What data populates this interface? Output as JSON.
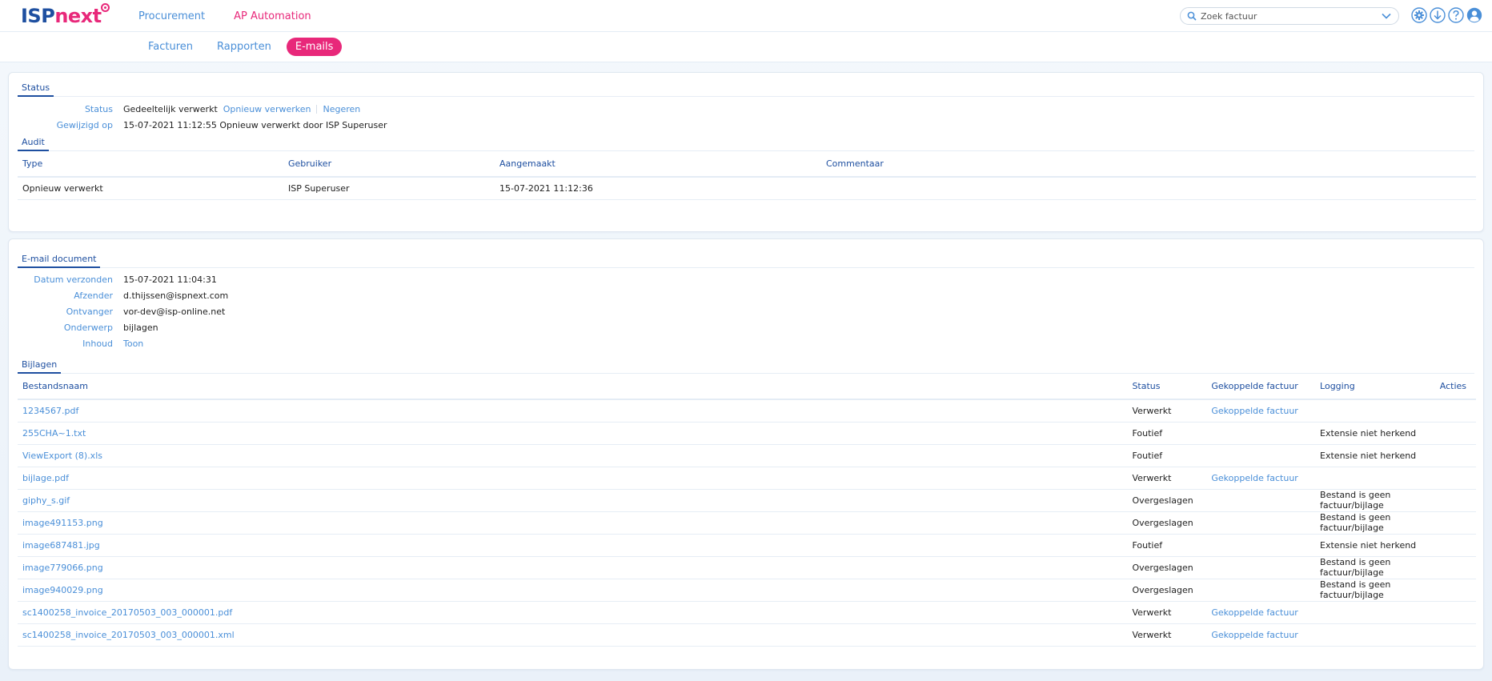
{
  "header": {
    "logo_isp": "ISP",
    "logo_next": "next",
    "nav": [
      "Procurement",
      "AP Automation"
    ],
    "search_placeholder": "Zoek factuur",
    "icons": [
      "settings-icon",
      "download-icon",
      "help-icon",
      "user-icon"
    ]
  },
  "subnav": {
    "tabs": [
      "Facturen",
      "Rapporten",
      "E-mails"
    ],
    "active": "E-mails"
  },
  "status_section": {
    "title": "Status",
    "rows": {
      "status_label": "Status",
      "status_value": "Gedeeltelijk verwerkt",
      "action_reprocess": "Opnieuw verwerken",
      "action_ignore": "Negeren",
      "modified_label": "Gewijzigd op",
      "modified_value": "15-07-2021 11:12:55 Opnieuw verwerkt door ISP Superuser"
    }
  },
  "audit_section": {
    "title": "Audit",
    "columns": [
      "Type",
      "Gebruiker",
      "Aangemaakt",
      "Commentaar"
    ],
    "rows": [
      [
        "Opnieuw verwerkt",
        "ISP Superuser",
        "15-07-2021 11:12:36",
        ""
      ]
    ]
  },
  "email_section": {
    "title": "E-mail document",
    "labels": [
      "Datum verzonden",
      "Afzender",
      "Ontvanger",
      "Onderwerp",
      "Inhoud"
    ],
    "values": [
      "15-07-2021 11:04:31",
      "d.thijssen@ispnext.com",
      "vor-dev@isp-online.net",
      "bijlagen",
      "Toon"
    ]
  },
  "attachments_section": {
    "title": "Bijlagen",
    "columns": [
      "Bestandsnaam",
      "Status",
      "Gekoppelde factuur",
      "Logging",
      "Acties"
    ],
    "rows": [
      [
        "1234567.pdf",
        "Verwerkt",
        "Gekoppelde factuur",
        ""
      ],
      [
        "255CHA~1.txt",
        "Foutief",
        "",
        "Extensie niet herkend"
      ],
      [
        "ViewExport (8).xls",
        "Foutief",
        "",
        "Extensie niet herkend"
      ],
      [
        "bijlage.pdf",
        "Verwerkt",
        "Gekoppelde factuur",
        ""
      ],
      [
        "giphy_s.gif",
        "Overgeslagen",
        "",
        "Bestand is geen factuur/bijlage"
      ],
      [
        "image491153.png",
        "Overgeslagen",
        "",
        "Bestand is geen factuur/bijlage"
      ],
      [
        "image687481.jpg",
        "Foutief",
        "",
        "Extensie niet herkend"
      ],
      [
        "image779066.png",
        "Overgeslagen",
        "",
        "Bestand is geen factuur/bijlage"
      ],
      [
        "image940029.png",
        "Overgeslagen",
        "",
        "Bestand is geen factuur/bijlage"
      ],
      [
        "sc1400258_invoice_20170503_003_000001.pdf",
        "Verwerkt",
        "Gekoppelde factuur",
        ""
      ],
      [
        "sc1400258_invoice_20170503_003_000001.xml",
        "Verwerkt",
        "Gekoppelde factuur",
        ""
      ]
    ]
  },
  "colors": {
    "brand_blue": "#1e4fa0",
    "link_blue": "#4a8fd8",
    "accent_pink": "#e8287a"
  }
}
